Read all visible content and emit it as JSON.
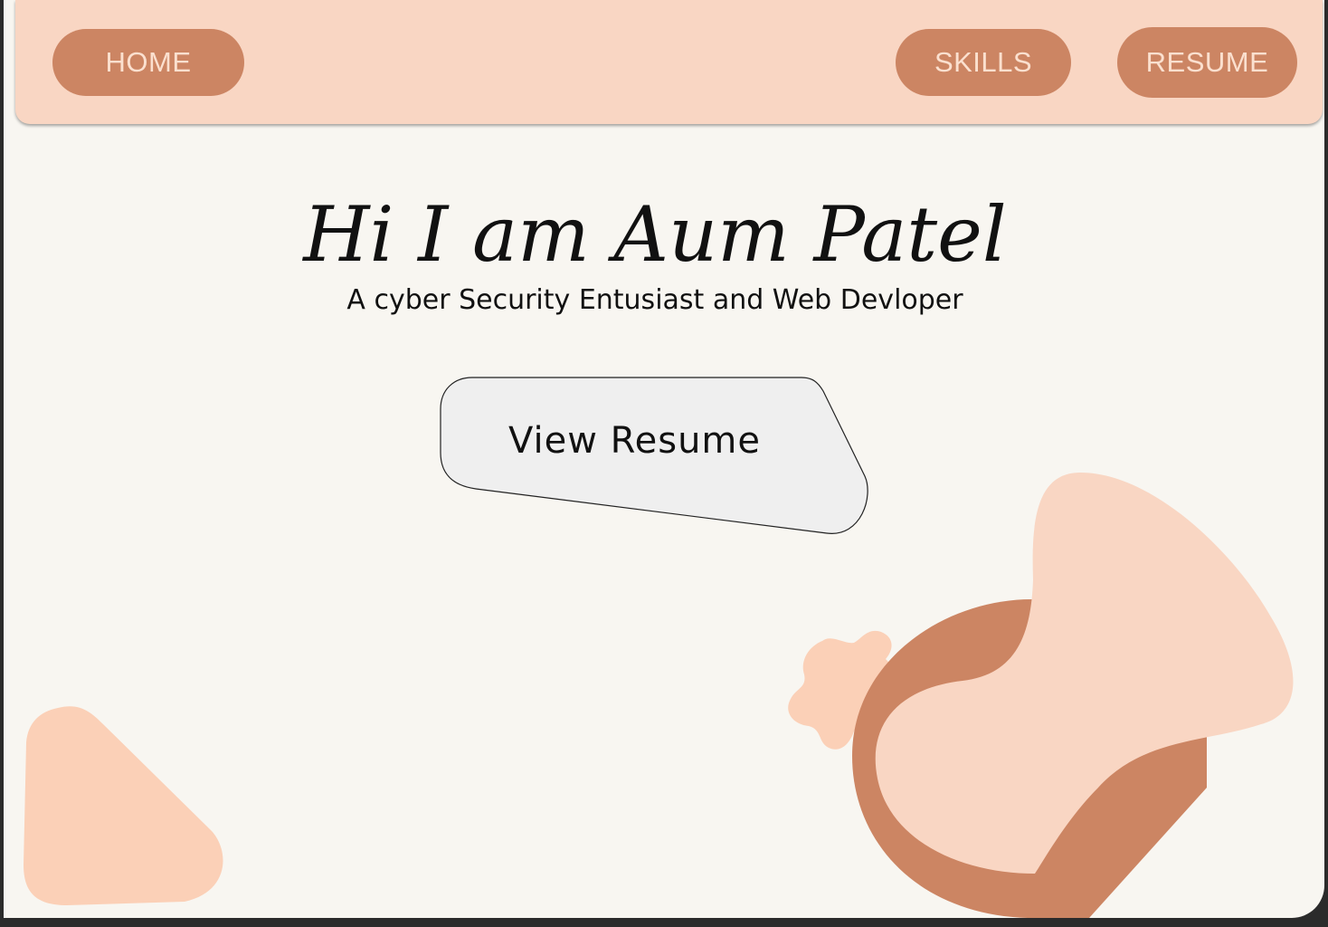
{
  "nav": {
    "home_label": "HOME",
    "skills_label": "SKILLS",
    "resume_label": "RESUME"
  },
  "hero": {
    "title": "Hi I am Aum Patel",
    "subtitle": "A cyber Security Entusiast and Web Devloper",
    "cta_label": "View Resume"
  },
  "colors": {
    "background": "#f8f6f1",
    "nav_background": "#f9d6c3",
    "button_fill": "#cc8563",
    "button_text": "#fbe0cf",
    "blob_light": "#f9d6c3",
    "blob_dark": "#cc8563",
    "cta_fill": "#efefef"
  }
}
